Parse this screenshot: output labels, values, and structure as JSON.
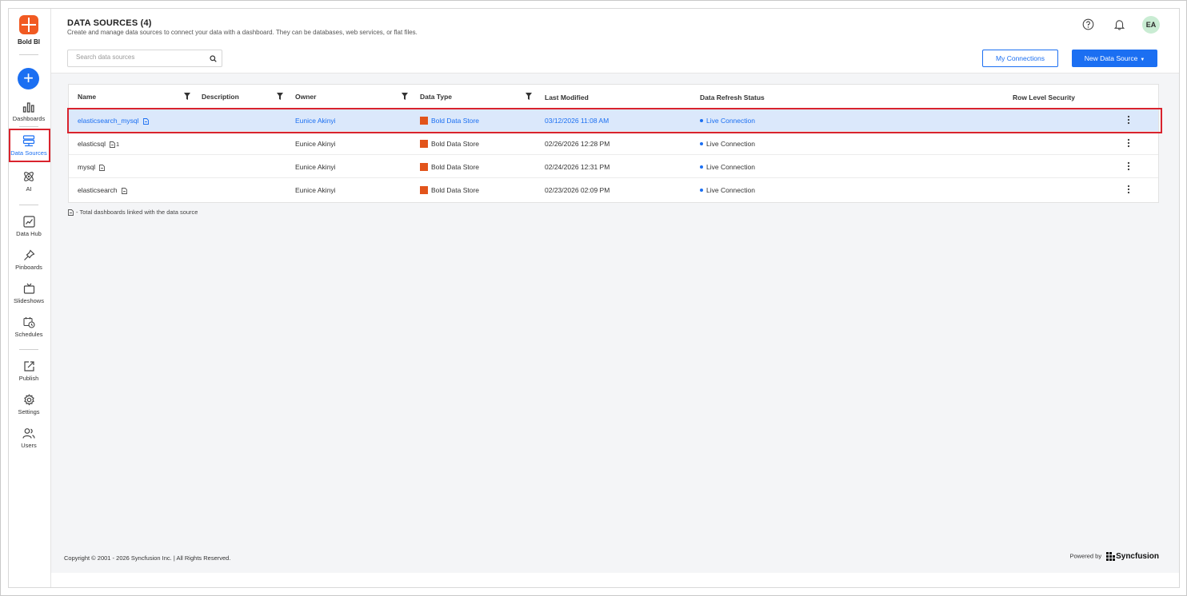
{
  "app": {
    "name": "Bold BI",
    "brand_color": "#1b6ff2",
    "logo_color": "#f15a22",
    "highlight_color": "#d9232d"
  },
  "sidebar": {
    "add_label": "+",
    "items": [
      {
        "label": "Dashboards",
        "icon": "bar-chart-icon"
      },
      {
        "label": "Data Sources",
        "icon": "data-source-icon",
        "active": true
      },
      {
        "label": "AI",
        "icon": "atom-icon"
      },
      {
        "label": "Data Hub",
        "icon": "data-hub-icon"
      },
      {
        "label": "Pinboards",
        "icon": "pin-icon"
      },
      {
        "label": "Slideshows",
        "icon": "slideshow-icon"
      },
      {
        "label": "Schedules",
        "icon": "calendar-clock-icon"
      },
      {
        "label": "Publish",
        "icon": "publish-icon"
      },
      {
        "label": "Settings",
        "icon": "gear-icon"
      },
      {
        "label": "Users",
        "icon": "users-icon"
      }
    ]
  },
  "header": {
    "title": "DATA SOURCES (4)",
    "subtitle": "Create and manage data sources to connect your data with a dashboard. They can be databases, web services, or flat files.",
    "search_placeholder": "Search data sources",
    "avatar_initials": "EA",
    "my_connections_label": "My Connections",
    "new_data_source_label": "New Data Source"
  },
  "grid": {
    "columns": [
      "Name",
      "Description",
      "Owner",
      "Data Type",
      "Last Modified",
      "Data Refresh Status",
      "Row Level Security"
    ],
    "rows": [
      {
        "name": "elasticsearch_mysql",
        "count": "",
        "description": "",
        "owner": "Eunice Akinyi",
        "data_type": "Bold Data Store",
        "last_modified": "03/12/2026 11:08 AM",
        "status": "Live Connection",
        "selected": true
      },
      {
        "name": "elasticsql",
        "count": "1",
        "description": "",
        "owner": "Eunice Akinyi",
        "data_type": "Bold Data Store",
        "last_modified": "02/26/2026 12:28 PM",
        "status": "Live Connection",
        "selected": false
      },
      {
        "name": "mysql",
        "count": "",
        "description": "",
        "owner": "Eunice Akinyi",
        "data_type": "Bold Data Store",
        "last_modified": "02/24/2026 12:31 PM",
        "status": "Live Connection",
        "selected": false
      },
      {
        "name": "elasticsearch",
        "count": "",
        "description": "",
        "owner": "Eunice Akinyi",
        "data_type": "Bold Data Store",
        "last_modified": "02/23/2026 02:09 PM",
        "status": "Live Connection",
        "selected": false
      }
    ]
  },
  "legend": "- Total dashboards linked with the data source",
  "footer": {
    "copyright": "Copyright © 2001 - 2026 Syncfusion Inc. | All Rights Reserved.",
    "powered_by": "Powered by",
    "brand": "Syncfusion"
  }
}
